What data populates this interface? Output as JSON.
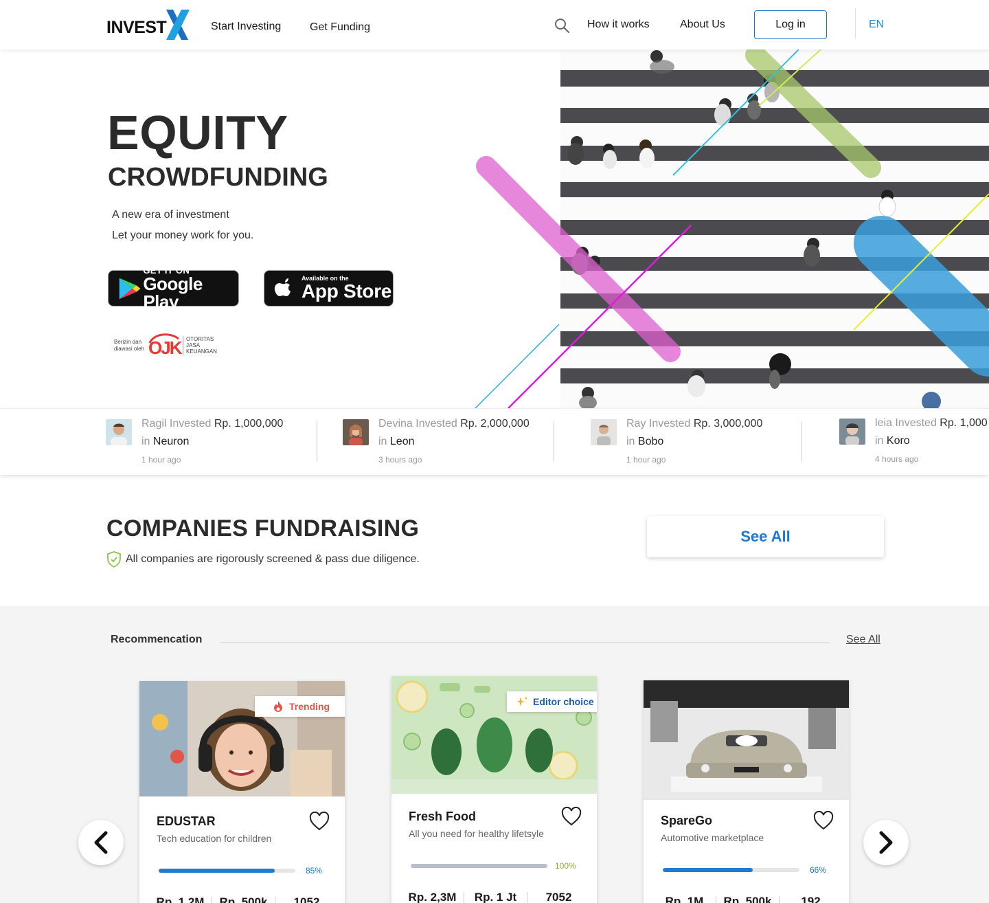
{
  "nav": {
    "logo_text": "INVEST",
    "links": [
      "Start Investing",
      "Get Funding",
      "How it works",
      "About Us"
    ],
    "login_label": "Log in",
    "language": "EN"
  },
  "hero": {
    "title": "EQUITY",
    "subtitle": "CROWDFUNDING",
    "line1": "A new era of investment",
    "line2": "Let your money work for you.",
    "google_play": {
      "small": "GET IT ON",
      "big": "Google Play"
    },
    "app_store": {
      "small": "Available on the",
      "big": "App Store"
    },
    "ojk": {
      "left1": "Berizin dan",
      "left2": "diawasi oleh",
      "mark": "OJK",
      "right1": "OTORITAS",
      "right2": "JASA",
      "right3": "KEUANGAN"
    }
  },
  "ticker": [
    {
      "name": "Ragil",
      "verb": "Invested",
      "amount": "Rp. 1,000,000",
      "prep": "in",
      "company": "Neuron",
      "time": "1 hour ago"
    },
    {
      "name": "Devina",
      "verb": "Invested",
      "amount": "Rp. 2,000,000",
      "prep": "in",
      "company": "Leon",
      "time": "3 hours ago"
    },
    {
      "name": "Ray",
      "verb": "Invested",
      "amount": "Rp. 3,000,000",
      "prep": "in",
      "company": "Bobo",
      "time": "1 hour ago"
    },
    {
      "name": "leia",
      "verb": "Invested",
      "amount": "Rp. 1,000",
      "prep": "in",
      "company": "Koro",
      "time": "4 hours ago"
    }
  ],
  "companies": {
    "title": "COMPANIES FUNDRAISING",
    "note": "All companies are rigorously screened & pass due diligence.",
    "see_all": "See All"
  },
  "recommendation": {
    "title": "Recommencation",
    "see_all": "See All",
    "cards": [
      {
        "name": "EDUSTAR",
        "desc": "Tech education for children",
        "badge": "Trending",
        "progress": 0.85,
        "pct": "85%",
        "stats": [
          "Rp. 1,2M",
          "Rp. 500k",
          "1052"
        ]
      },
      {
        "name": "Fresh Food",
        "desc": "All you need for healthy lifetsyle",
        "badge": "Editor choice",
        "progress": 1.0,
        "pct": "100%",
        "stats": [
          "Rp. 2,3M",
          "Rp. 1 Jt",
          "7052"
        ]
      },
      {
        "name": "SpareGo",
        "desc": "Automotive marketplace",
        "badge": "",
        "progress": 0.66,
        "pct": "66%",
        "stats": [
          "Rp. 1M",
          "Rp. 500k",
          "192"
        ]
      }
    ]
  },
  "colors": {
    "accent": "#1a7ad1",
    "trending": "#e8534a",
    "editor": "#1a5fa8",
    "complete": "#8ab02a"
  }
}
